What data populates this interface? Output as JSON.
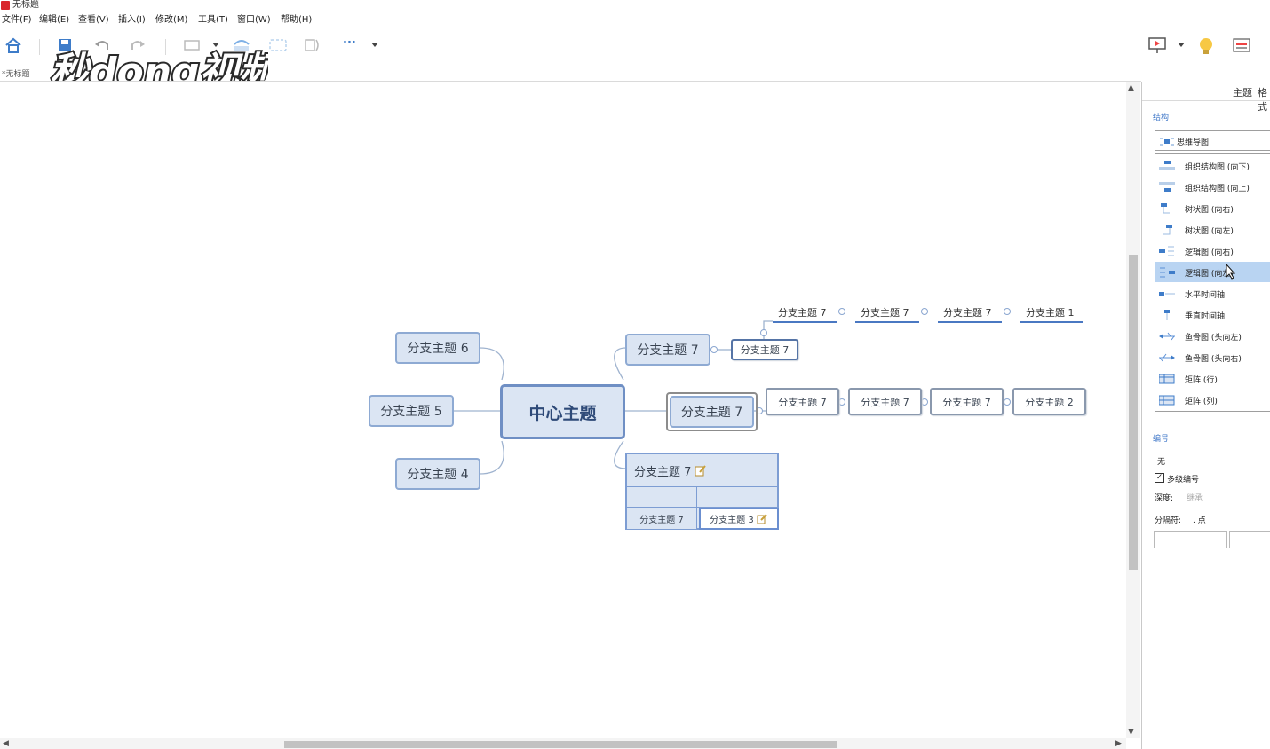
{
  "window": {
    "title": "无标题"
  },
  "menu": [
    "文件(F)",
    "编辑(E)",
    "查看(V)",
    "插入(I)",
    "修改(M)",
    "工具(T)",
    "窗口(W)",
    "帮助(H)"
  ],
  "toolbar": {
    "icons": [
      "home-icon",
      "save-icon",
      "undo-icon",
      "redo-icon",
      "topic-icon",
      "dropdown-icon",
      "relationship-icon",
      "boundary-icon",
      "summary-icon",
      "more-icon",
      "presentation-icon",
      "idea-icon",
      "panel-icon"
    ],
    "more_label": "···"
  },
  "logo": {
    "text": "秒dong视频"
  },
  "document_tab": {
    "label": "*无标题"
  },
  "mindmap": {
    "center": "中心主题",
    "left_topics": [
      "分支主题 6",
      "分支主题 5",
      "分支主题 4"
    ],
    "right_top": {
      "label": "分支主题 7",
      "child": "分支主题 7",
      "grandchildren": [
        "分支主题 7",
        "分支主题 7",
        "分支主题 7",
        "分支主题 1"
      ]
    },
    "right_middle": {
      "label": "分支主题 7",
      "children": [
        "分支主题 7",
        "分支主题 7",
        "分支主题 7",
        "分支主题 2"
      ]
    },
    "right_bottom": {
      "label": "分支主题 7",
      "cells": [
        "分支主题 7",
        "分支主题 3"
      ]
    }
  },
  "panel": {
    "tabs": [
      "主题",
      "格式"
    ],
    "structure_label": "结构",
    "structure_selected": "思维导图",
    "structure_options": [
      "组织结构图 (向下)",
      "组织结构图 (向上)",
      "树状图 (向右)",
      "树状图 (向左)",
      "逻辑图 (向右)",
      "逻辑图 (向左)",
      "水平时间轴",
      "垂直时间轴",
      "鱼骨图 (头向左)",
      "鱼骨图 (头向右)",
      "矩阵 (行)",
      "矩阵 (列)"
    ],
    "highlighted_option_index": 5,
    "numbering_label": "编号",
    "numbering_value": "无",
    "multilevel_label": "多级编号",
    "multilevel_checked": true,
    "depth_label": "深度:",
    "depth_value": "继承",
    "separator_label": "分隔符:",
    "separator_value": ". 点"
  },
  "colors": {
    "accent": "#4a78c2",
    "topic_fill": "#dbe5f3",
    "topic_border": "#8eaad3",
    "highlight": "#b9d4f2"
  }
}
